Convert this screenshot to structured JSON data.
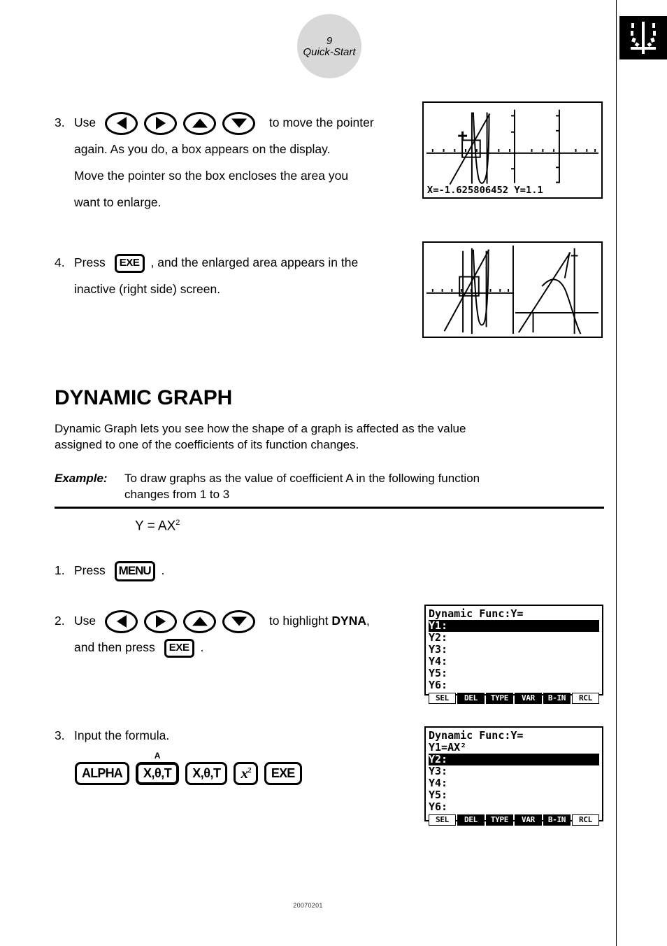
{
  "page": {
    "number": "9",
    "section": "Quick-Start",
    "footer_code": "20070201",
    "corner_tab_icon": "dynamic-graph-icon"
  },
  "steps_top": [
    {
      "num": "3.",
      "lead": "Use",
      "keys": [
        "left-arrow",
        "right-arrow",
        "up-arrow",
        "down-arrow"
      ],
      "text_after": "to move the pointer",
      "lines": [
        "again. As you do, a box appears on the display.",
        "Move the pointer so the box encloses the area you",
        "want to enlarge."
      ]
    },
    {
      "num": "4.",
      "lead": "Press",
      "key_label": "EXE",
      "text_after": ", and the enlarged area appears in the",
      "lines": [
        "inactive (right side) screen."
      ]
    }
  ],
  "section": {
    "title": "DYNAMIC GRAPH",
    "description_lines": [
      "Dynamic Graph lets you see how the shape of a graph is affected as the value",
      "assigned to one of the coefficients of its function changes."
    ],
    "example_label": "Example:",
    "example_lines": [
      "To draw graphs as the value of coefficient A in the following  function",
      "changes from 1 to 3"
    ],
    "formula": "Y = AX",
    "formula_exponent": "2"
  },
  "steps_dyna": [
    {
      "num": "1.",
      "lead": "Press",
      "key_label": "MENU",
      "text_after": "."
    },
    {
      "num": "2.",
      "lead": "Use",
      "keys": [
        "left-arrow",
        "right-arrow",
        "up-arrow",
        "down-arrow"
      ],
      "text_after": "to highlight",
      "bold_target": "DYNA",
      "comma": ",",
      "line2_lead": "and then press",
      "line2_key": "EXE",
      "line2_after": "."
    },
    {
      "num": "3.",
      "text": "Input the formula."
    }
  ],
  "key_sequence": {
    "above_label": "A",
    "keys": [
      {
        "name": "alpha-key",
        "label": "ALPHA",
        "style": "plain",
        "emphasized": false
      },
      {
        "name": "x-theta-t-key",
        "label": "X,θ,T",
        "style": "xth",
        "emphasized": true
      },
      {
        "name": "x-theta-t-key",
        "label": "X,θ,T",
        "style": "xth",
        "emphasized": false
      },
      {
        "name": "x-squared-key",
        "label": "x",
        "exponent": "2",
        "style": "xsq",
        "emphasized": false
      },
      {
        "name": "exe-key",
        "label": "EXE",
        "style": "plain",
        "emphasized": false
      }
    ]
  },
  "lcd_screens": {
    "graph_pointer": {
      "name": "graph-with-pointer-box-screen",
      "status_line": "X=-1.625806452   Y=1.1"
    },
    "split_graph": {
      "name": "split-screen-zoom-result"
    },
    "dyna_empty": {
      "name": "dynamic-func-list-empty",
      "title": "Dynamic Func:Y=",
      "rows": [
        {
          "label": "Y1:",
          "value": "",
          "selected": true
        },
        {
          "label": "Y2:",
          "value": "",
          "selected": false
        },
        {
          "label": "Y3:",
          "value": "",
          "selected": false
        },
        {
          "label": "Y4:",
          "value": "",
          "selected": false
        },
        {
          "label": "Y5:",
          "value": "",
          "selected": false
        },
        {
          "label": "Y6:",
          "value": "",
          "selected": false
        }
      ],
      "fkeys": [
        {
          "label": "SEL",
          "inverted": false
        },
        {
          "label": "DEL",
          "inverted": true
        },
        {
          "label": "TYPE",
          "inverted": true
        },
        {
          "label": "VAR",
          "inverted": true
        },
        {
          "label": "B-IN",
          "inverted": true
        },
        {
          "label": "RCL",
          "inverted": false
        }
      ]
    },
    "dyna_filled": {
      "name": "dynamic-func-list-with-formula",
      "title": "Dynamic Func:Y=",
      "rows": [
        {
          "label": "Y1=AX²",
          "value": "",
          "selected": false
        },
        {
          "label": "Y2:",
          "value": "",
          "selected": true
        },
        {
          "label": "Y3:",
          "value": "",
          "selected": false
        },
        {
          "label": "Y4:",
          "value": "",
          "selected": false
        },
        {
          "label": "Y5:",
          "value": "",
          "selected": false
        },
        {
          "label": "Y6:",
          "value": "",
          "selected": false
        }
      ],
      "fkeys": [
        {
          "label": "SEL",
          "inverted": false
        },
        {
          "label": "DEL",
          "inverted": true
        },
        {
          "label": "TYPE",
          "inverted": true
        },
        {
          "label": "VAR",
          "inverted": true
        },
        {
          "label": "B-IN",
          "inverted": true
        },
        {
          "label": "RCL",
          "inverted": false
        }
      ]
    }
  }
}
